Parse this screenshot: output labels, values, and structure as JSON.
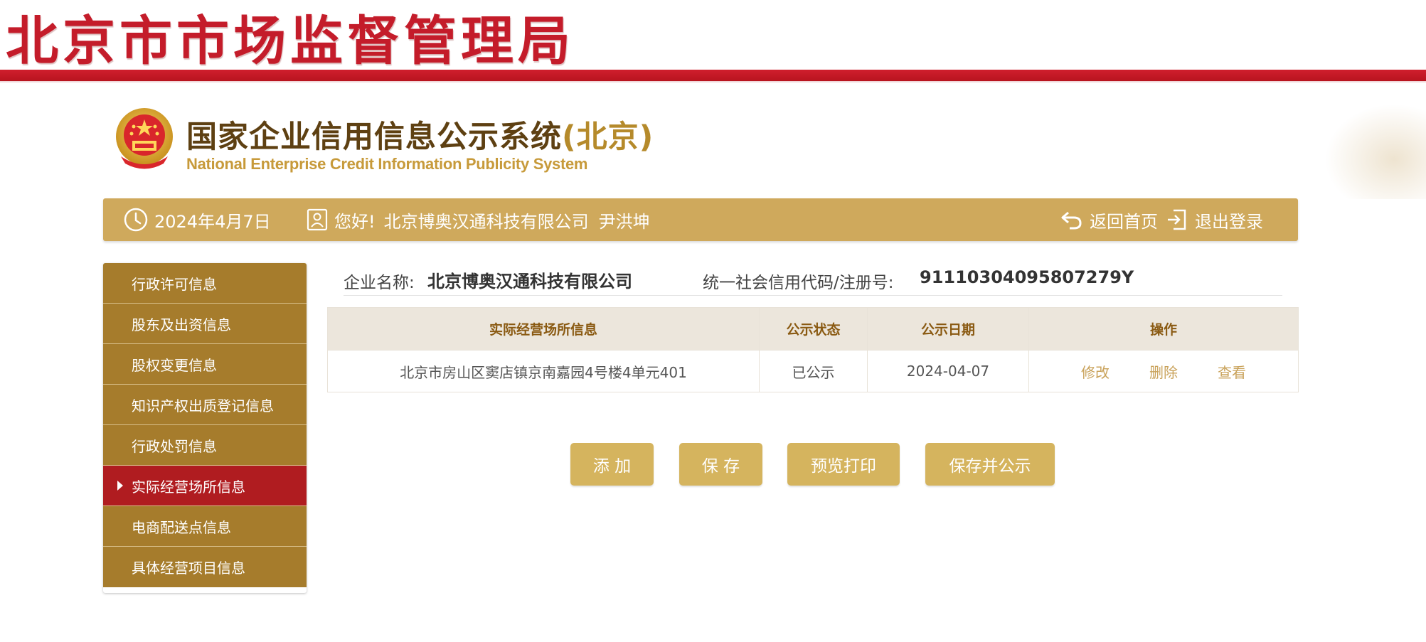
{
  "banner": {
    "agency_title": "北京市市场监督管理局"
  },
  "system": {
    "title_main": "国家企业信用信息公示系统",
    "title_region": "(北京)",
    "subtitle": "National Enterprise Credit Information Publicity System"
  },
  "header": {
    "date": "2024年4月7日",
    "greeting": "您好!",
    "company": "北京博奥汉通科技有限公司",
    "user": "尹洪坤",
    "home_label": "返回首页",
    "logout_label": "退出登录"
  },
  "sidebar": {
    "items": [
      {
        "label": "行政许可信息"
      },
      {
        "label": "股东及出资信息"
      },
      {
        "label": "股权变更信息"
      },
      {
        "label": "知识产权出质登记信息"
      },
      {
        "label": "行政处罚信息"
      },
      {
        "label": "实际经营场所信息"
      },
      {
        "label": "电商配送点信息"
      },
      {
        "label": "具体经营项目信息"
      }
    ],
    "active_index": 5
  },
  "company_info": {
    "name_label": "企业名称:",
    "name_value": "北京博奥汉通科技有限公司",
    "code_label": "统一社会信用代码/注册号:",
    "code_value": "91110304095807279Y"
  },
  "table": {
    "headers": [
      "实际经营场所信息",
      "公示状态",
      "公示日期",
      "操作"
    ],
    "rows": [
      {
        "address": "北京市房山区窦店镇京南嘉园4号楼4单元401",
        "status": "已公示",
        "date": "2024-04-07",
        "actions": [
          "修改",
          "删除",
          "查看"
        ]
      }
    ]
  },
  "buttons": {
    "add": "添 加",
    "save": "保 存",
    "preview_print": "预览打印",
    "save_publish": "保存并公示"
  },
  "colors": {
    "brand_red": "#c41c2a",
    "gold_bar": "#cfa95c",
    "sidebar_gold": "#a67c2c",
    "sidebar_active": "#b01c20",
    "button_gold": "#d5b45e",
    "link_gold": "#c9a25a"
  }
}
